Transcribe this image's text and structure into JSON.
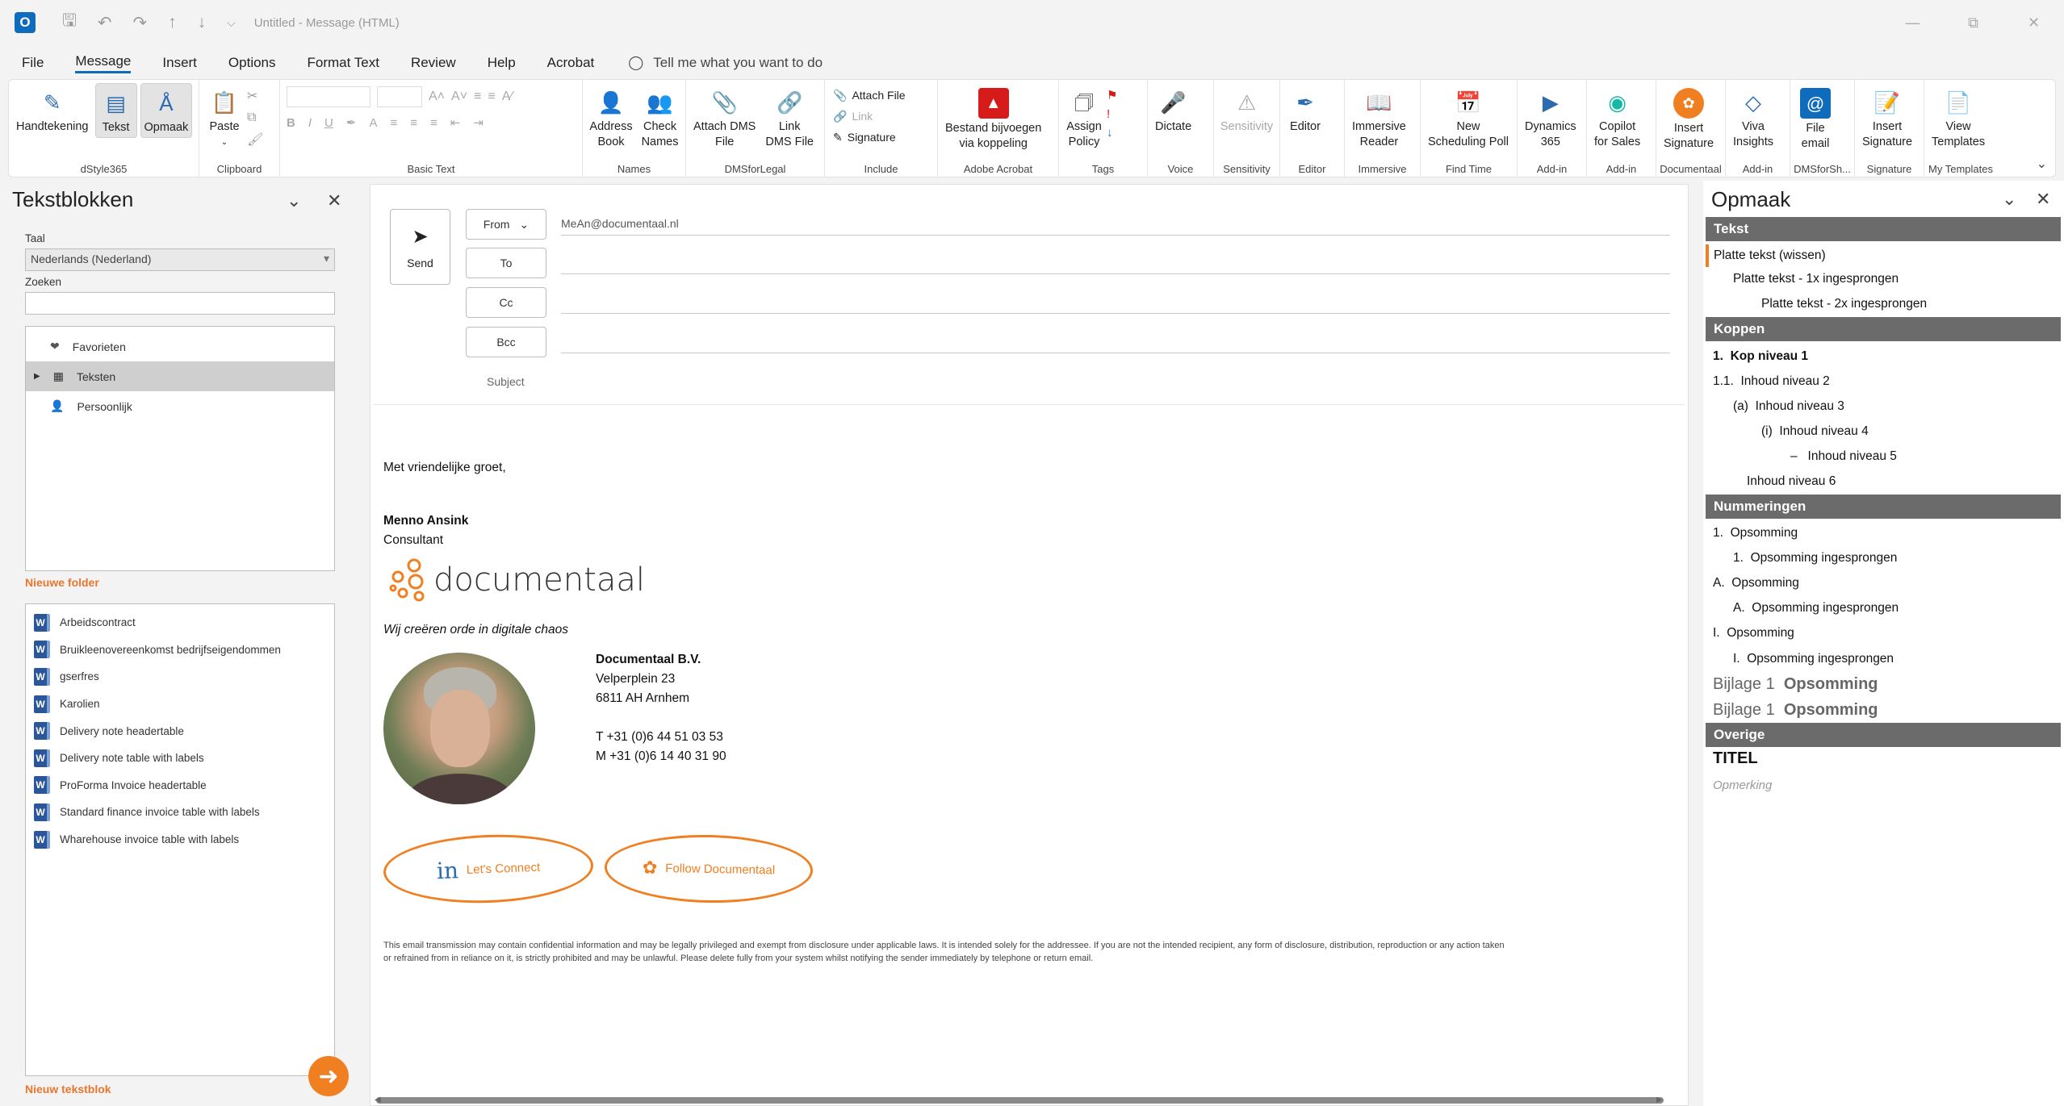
{
  "titlebar": {
    "app_icon": "O",
    "title": "Untitled  -  Message (HTML)",
    "quick_access": [
      "save-icon",
      "undo-icon",
      "redo-icon",
      "up-icon",
      "down-icon",
      "customize-icon"
    ]
  },
  "menu": {
    "items": [
      "File",
      "Message",
      "Insert",
      "Options",
      "Format Text",
      "Review",
      "Help",
      "Acrobat"
    ],
    "active": "Message",
    "tell": "Tell me what you want to do"
  },
  "ribbon": {
    "dstyle": {
      "label": "dStyle365",
      "buttons": [
        "Handtekening",
        "Tekst",
        "Opmaak"
      ]
    },
    "clipboard": {
      "label": "Clipboard",
      "paste": "Paste"
    },
    "basictext": {
      "label": "Basic Text",
      "bold": "B",
      "italic": "I",
      "underline": "U"
    },
    "names": {
      "label": "Names",
      "address1": "Address",
      "address2": "Book",
      "check1": "Check",
      "check2": "Names"
    },
    "dms": {
      "label": "DMSforLegal",
      "attach1": "Attach DMS",
      "attach2": "File",
      "link1": "Link",
      "link2": "DMS File"
    },
    "include": {
      "label": "Include",
      "attach": "Attach File",
      "link": "Link",
      "signature": "Signature"
    },
    "adobe": {
      "label": "Adobe Acrobat",
      "b1": "Bestand bijvoegen",
      "b2": "via koppeling"
    },
    "tags": {
      "label": "Tags",
      "assign1": "Assign",
      "assign2": "Policy"
    },
    "voice": {
      "label": "Voice",
      "dictate": "Dictate"
    },
    "sensitivity": {
      "label": "Sensitivity",
      "btn": "Sensitivity"
    },
    "editor": {
      "label": "Editor",
      "btn": "Editor"
    },
    "immersive": {
      "label": "Immersive",
      "b1": "Immersive",
      "b2": "Reader"
    },
    "findtime": {
      "label": "Find Time",
      "b1": "New",
      "b2": "Scheduling Poll"
    },
    "addin1": {
      "label": "Add-in",
      "b1": "Dynamics",
      "b2": "365"
    },
    "addin2": {
      "label": "Add-in",
      "b1": "Copilot",
      "b2": "for Sales"
    },
    "documentaal": {
      "label": "Documentaal",
      "b1": "Insert",
      "b2": "Signature"
    },
    "addin3": {
      "label": "Add-in",
      "b1": "Viva",
      "b2": "Insights"
    },
    "dmsforsh": {
      "label": "DMSforSh...",
      "b1": "File",
      "b2": "email"
    },
    "signature": {
      "label": "Signature",
      "b1": "Insert",
      "b2": "Signature"
    },
    "templates": {
      "label": "My Templates",
      "b1": "View",
      "b2": "Templates"
    }
  },
  "left": {
    "title": "Tekstblokken",
    "taal_label": "Taal",
    "taal_value": "Nederlands (Nederland)",
    "zoeken_label": "Zoeken",
    "tree": [
      "Favorieten",
      "Teksten",
      "Persoonlijk"
    ],
    "new_folder": "Nieuwe folder",
    "docs": [
      "Arbeidscontract",
      "Bruikleenovereenkomst bedrijfseigendommen",
      "gserfres",
      "Karolien",
      "Delivery note headertable",
      "Delivery note table with labels",
      "ProForma Invoice headertable",
      "Standard finance invoice table with labels",
      "Wharehouse invoice table with labels"
    ],
    "new_block": "Nieuw tekstblok"
  },
  "compose": {
    "send": "Send",
    "from": "From",
    "from_value": "MeAn@documentaal.nl",
    "to": "To",
    "cc": "Cc",
    "bcc": "Bcc",
    "subject": "Subject",
    "greeting": "Met vriendelijke groet,",
    "name": "Menno Ansink",
    "role": "Consultant",
    "logo": "documentaal",
    "tagline": "Wij creëren orde in digitale chaos",
    "company": "Documentaal B.V.",
    "street": "Velperplein 23",
    "city": "6811 AH  Arnhem",
    "tel": "T +31 (0)6 44 51 03 53",
    "mob": "M +31 (0)6 14 40 31 90",
    "connect": "Let's Connect",
    "follow": "Follow Documentaal",
    "disclaimer": "This email transmission may contain confidential information and may be legally privileged and exempt from disclosure under applicable laws. It is intended solely for the addressee. If you are not the intended recipient, any form of disclosure, distribution, reproduction or any action taken or refrained from in reliance on it, is strictly prohibited and may be unlawful. Please delete fully from your system whilst notifying the sender immediately by telephone or return email."
  },
  "right": {
    "title": "Opmaak",
    "sections": {
      "tekst": "Tekst",
      "koppen": "Koppen",
      "nummeringen": "Nummeringen",
      "overige": "Overige"
    },
    "tekst": [
      "Platte tekst (wissen)",
      "Platte tekst - 1x ingesprongen",
      "Platte tekst - 2x ingesprongen"
    ],
    "koppen": [
      {
        "num": "1.",
        "text": "Kop niveau 1"
      },
      {
        "num": "1.1.",
        "text": "Inhoud niveau 2"
      },
      {
        "num": "(a)",
        "text": "Inhoud niveau 3"
      },
      {
        "num": "(i)",
        "text": "Inhoud niveau 4"
      },
      {
        "num": "–",
        "text": "Inhoud niveau 5"
      },
      {
        "num": "",
        "text": "Inhoud niveau 6"
      }
    ],
    "numm": [
      {
        "num": "1.",
        "text": "Opsomming"
      },
      {
        "num": "1.",
        "text": "Opsomming ingesprongen"
      },
      {
        "num": "A.",
        "text": "Opsomming"
      },
      {
        "num": "A.",
        "text": "Opsomming ingesprongen"
      },
      {
        "num": "I.",
        "text": "Opsomming"
      },
      {
        "num": "I.",
        "text": "Opsomming ingesprongen"
      },
      {
        "num": "Bijlage 1",
        "text": "Opsomming"
      },
      {
        "num": "Bijlage 1",
        "text": "Opsomming"
      }
    ],
    "titel": "TITEL",
    "opmerking": "Opmerking"
  },
  "colors": {
    "accent": "#0f6cbd",
    "orange": "#f07f22",
    "section": "#6b6b6b"
  }
}
